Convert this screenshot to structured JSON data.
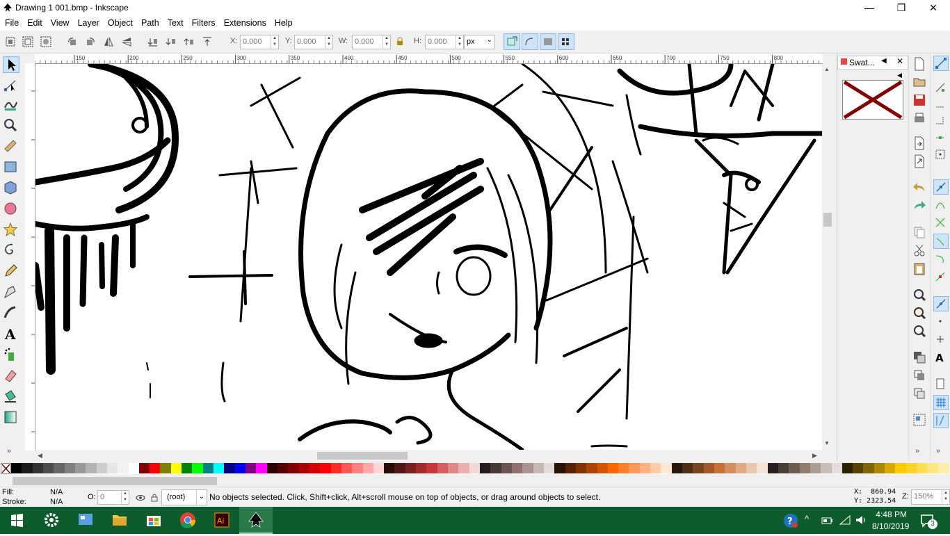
{
  "window": {
    "title": "Drawing 1 001.bmp - Inkscape",
    "controls": {
      "minimize": "—",
      "maximize": "❐",
      "close": "✕"
    }
  },
  "menu": [
    "File",
    "Edit",
    "View",
    "Layer",
    "Object",
    "Path",
    "Text",
    "Filters",
    "Extensions",
    "Help"
  ],
  "toolbar": {
    "x_label": "X:",
    "x_value": "0.000",
    "y_label": "Y:",
    "y_value": "0.000",
    "w_label": "W:",
    "w_value": "0.000",
    "h_label": "H:",
    "h_value": "0.000",
    "unit": "px"
  },
  "ruler": {
    "ticks": [
      "150",
      "200",
      "250",
      "300",
      "350",
      "400",
      "450",
      "500",
      "550",
      "600",
      "650",
      "700",
      "750",
      "800",
      "850"
    ]
  },
  "dock": {
    "tab_title": "Swat...",
    "swatch_selected": "none"
  },
  "palette": {
    "colors": [
      "#000000",
      "#1a1a1a",
      "#333333",
      "#4d4d4d",
      "#666666",
      "#808080",
      "#999999",
      "#b3b3b3",
      "#cccccc",
      "#e6e6e6",
      "#f2f2f2",
      "#ffffff",
      "#800000",
      "#ff0000",
      "#808000",
      "#ffff00",
      "#008000",
      "#00ff00",
      "#008080",
      "#00ffff",
      "#000080",
      "#0000ff",
      "#800080",
      "#ff00ff",
      "#2b0000",
      "#550000",
      "#800000",
      "#aa0000",
      "#d40000",
      "#ff0000",
      "#ff2a2a",
      "#ff5555",
      "#ff8080",
      "#ffaaaa",
      "#ffd5d5",
      "#280b0b",
      "#501616",
      "#782121",
      "#a02c2c",
      "#c83737",
      "#d35f5f",
      "#de8787",
      "#e9afaf",
      "#f4d7d7",
      "#241c1c",
      "#483737",
      "#6c5353",
      "#916f6f",
      "#ac9393",
      "#c8b7b7",
      "#e3dbdb",
      "#2b1100",
      "#552200",
      "#803300",
      "#aa4400",
      "#d45500",
      "#ff6600",
      "#ff7f2a",
      "#ff9955",
      "#ffb380",
      "#ffccaa",
      "#ffe6d5",
      "#28170b",
      "#502d16",
      "#784421",
      "#a05a2c",
      "#c87137",
      "#d38d5f",
      "#deaa87",
      "#e9c6af",
      "#f4e3d7",
      "#241f1c",
      "#483e37",
      "#6c5d53",
      "#917c6f",
      "#ac9d93",
      "#c8beb7",
      "#e3dedb",
      "#2b2200",
      "#554400",
      "#806600",
      "#aa8800",
      "#d4aa00",
      "#ffcc00",
      "#ffd42a",
      "#ffdd55",
      "#ffe680",
      "#ffeeaa"
    ]
  },
  "status": {
    "fill_label": "Fill:",
    "fill_value": "N/A",
    "stroke_label": "Stroke:",
    "stroke_value": "N/A",
    "opacity_label": "O:",
    "opacity_value": "0",
    "layer": "(root)",
    "message": "No objects selected. Click, Shift+click, Alt+scroll mouse on top of objects, or drag around objects to select.",
    "x_coord": "X:  860.94",
    "y_coord": "Y: 2323.54",
    "zoom_label": "Z:",
    "zoom_value": "150%"
  },
  "taskbar": {
    "time": "4:48 PM",
    "date": "8/10/2019",
    "notifications": "3",
    "apps": [
      "settings-icon",
      "control-panel-icon",
      "file-explorer-icon",
      "store-icon",
      "chrome-icon",
      "illustrator-icon",
      "inkscape-icon"
    ]
  }
}
